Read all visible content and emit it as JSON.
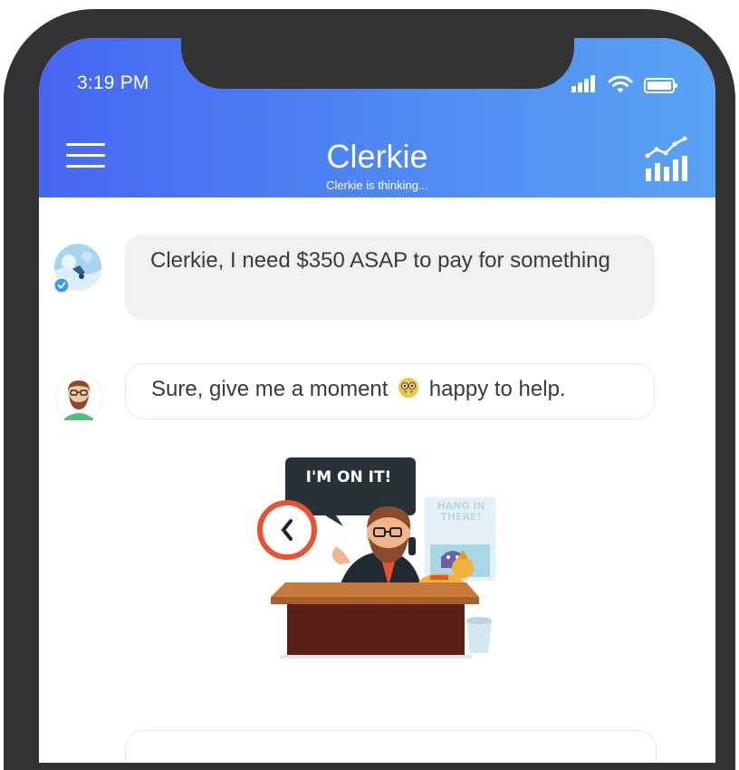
{
  "status_bar": {
    "time": "3:19 PM"
  },
  "header": {
    "title": "Clerkie",
    "subtitle": "Clerkie is thinking...",
    "menu_icon": "hamburger-menu-icon",
    "stats_icon": "bar-chart-trend-icon",
    "gradient": [
      "#4766f3",
      "#5aa2f4"
    ]
  },
  "chat": {
    "messages": [
      {
        "sender": "user",
        "text": "Clerkie, I need $350 ASAP to pay for something",
        "verified": true
      },
      {
        "sender": "clerkie",
        "text_before_emoji": "Sure, give me a moment",
        "emoji": "nerd-face",
        "text_after_emoji": "happy to help."
      }
    ],
    "illustration": {
      "speech_bubble": "I'M ON IT!",
      "poster": "HANG IN THERE!"
    }
  },
  "colors": {
    "frame": "#333333",
    "user_bubble": "#f1f1f1",
    "text": "#3a3a3a"
  }
}
